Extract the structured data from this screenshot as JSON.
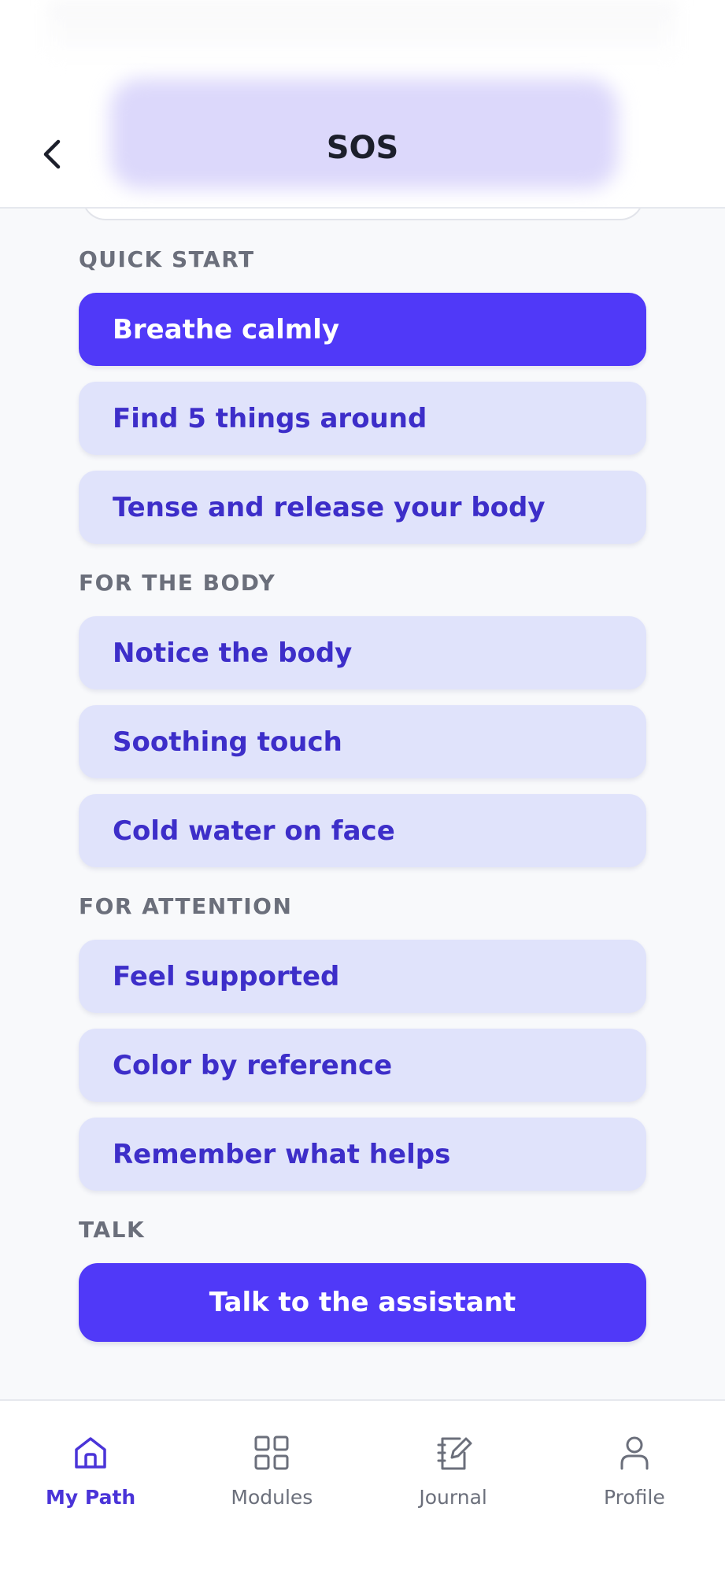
{
  "header": {
    "title": "SOS",
    "back_icon": "chevron-left-icon"
  },
  "sections": [
    {
      "label": "QUICK START",
      "items": [
        {
          "label": "Breathe calmly",
          "style": "primary"
        },
        {
          "label": "Find 5 things around",
          "style": "secondary"
        },
        {
          "label": "Tense and release your body",
          "style": "secondary"
        }
      ]
    },
    {
      "label": "FOR THE BODY",
      "items": [
        {
          "label": "Notice the body",
          "style": "secondary"
        },
        {
          "label": "Soothing touch",
          "style": "secondary"
        },
        {
          "label": "Cold water on face",
          "style": "secondary"
        }
      ]
    },
    {
      "label": "FOR ATTENTION",
      "items": [
        {
          "label": "Feel supported",
          "style": "secondary"
        },
        {
          "label": "Color by reference",
          "style": "secondary"
        },
        {
          "label": "Remember what helps",
          "style": "secondary"
        }
      ]
    },
    {
      "label": "TALK",
      "talk_button": "Talk to the assistant"
    }
  ],
  "bottom_nav": [
    {
      "label": "My Path",
      "icon": "home-icon",
      "active": true
    },
    {
      "label": "Modules",
      "icon": "grid-icon",
      "active": false
    },
    {
      "label": "Journal",
      "icon": "journal-icon",
      "active": false
    },
    {
      "label": "Profile",
      "icon": "profile-icon",
      "active": false
    }
  ],
  "colors": {
    "accent": "#5039f8",
    "button_tint": "#e0e3fb",
    "button_text": "#3d2ec9",
    "section_label": "#6b6f7b",
    "background": "#f8f9fb"
  }
}
